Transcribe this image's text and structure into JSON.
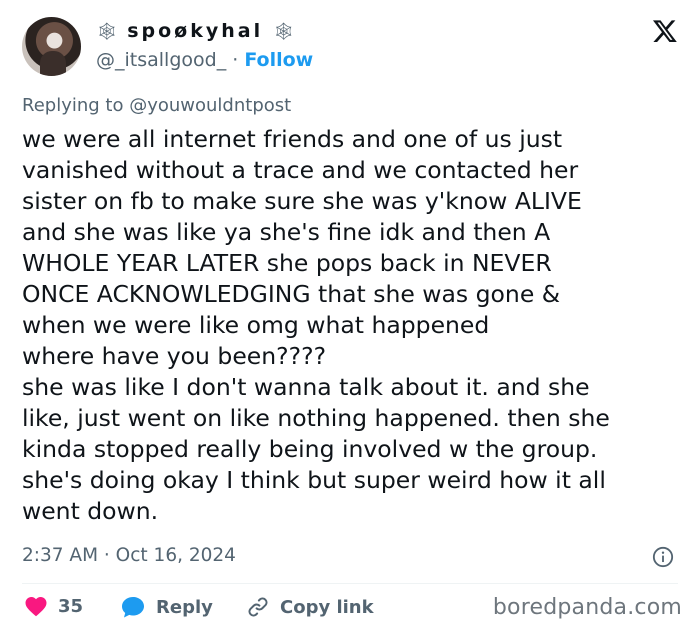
{
  "author": {
    "display_name": "spoøkyhal",
    "decoration_left": "🕸",
    "decoration_right": "🕸",
    "handle": "@_itsallgood_",
    "separator": "·",
    "follow_label": "Follow"
  },
  "reply_to": {
    "prefix": "Replying to",
    "handle": "@youwouldntpost"
  },
  "tweet_lines": [
    "we were all internet friends and one of us just",
    "vanished without a trace and we contacted her",
    "sister on fb to make sure she was y'know ALIVE",
    "and she was like ya she's fine idk and then A",
    "WHOLE YEAR LATER she pops back in NEVER",
    "ONCE ACKNOWLEDGING that she was gone &",
    "when we were like omg what happened",
    "where have you been????",
    "she was like I don't wanna talk about it. and she",
    "like, just went on like nothing happened. then she",
    "kinda stopped really being involved w the group.",
    "she's doing okay I think but super weird how it all",
    "went down."
  ],
  "timestamp": "2:37 AM · Oct 16, 2024",
  "actions": {
    "like_count": "35",
    "reply_label": "Reply",
    "copy_link_label": "Copy link"
  },
  "watermark": "boredpanda.com",
  "colors": {
    "accent": "#1d9bf0",
    "heart": "#f91880",
    "muted": "#536471",
    "text": "#0f1419"
  },
  "icons": [
    "x-logo-icon",
    "heart-icon",
    "reply-bubble-icon",
    "link-icon",
    "info-icon"
  ]
}
